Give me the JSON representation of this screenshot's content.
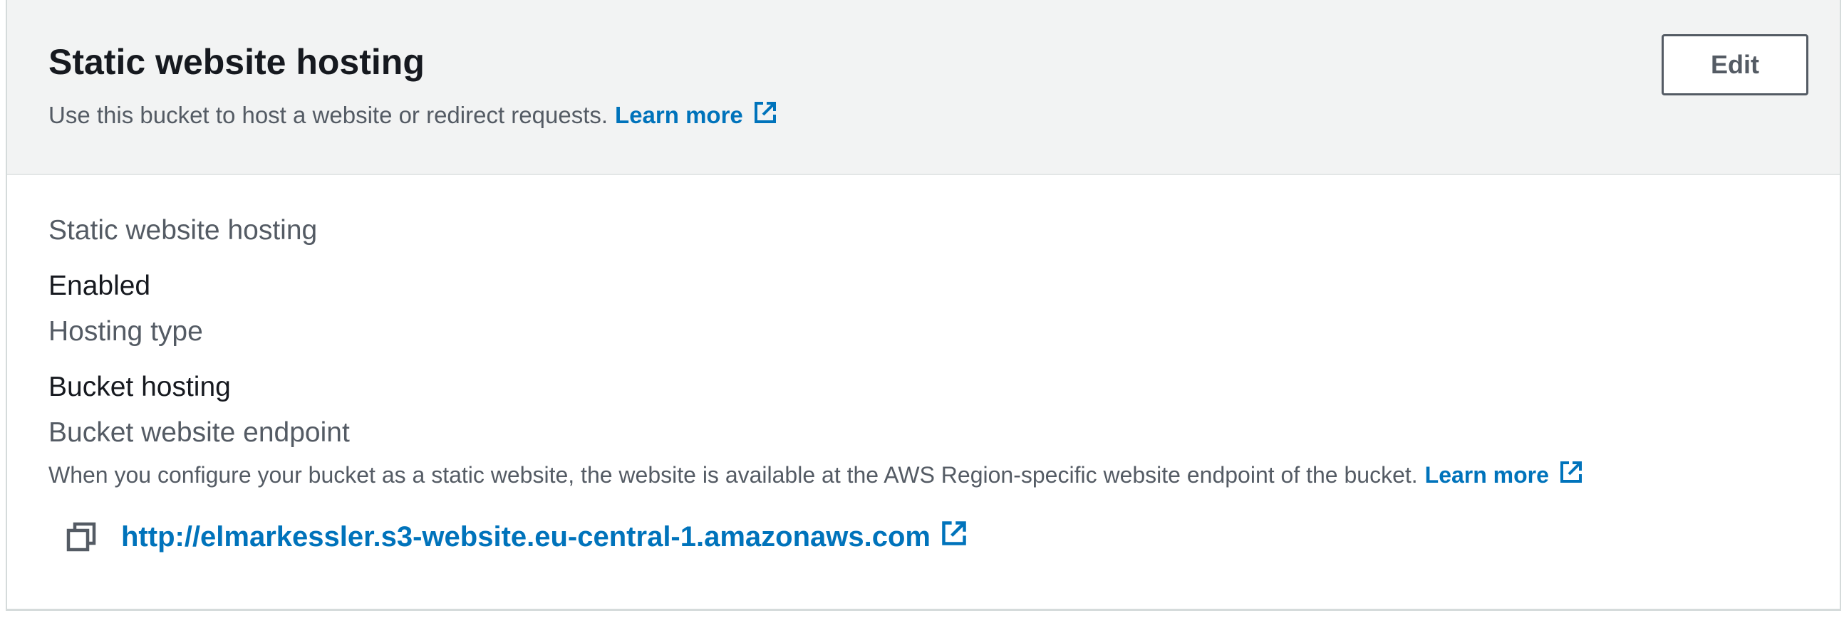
{
  "header": {
    "title": "Static website hosting",
    "description": "Use this bucket to host a website or redirect requests.",
    "learn_more_label": "Learn more",
    "edit_label": "Edit"
  },
  "details": {
    "hosting_label": "Static website hosting",
    "hosting_value": "Enabled",
    "type_label": "Hosting type",
    "type_value": "Bucket hosting",
    "endpoint_label": "Bucket website endpoint",
    "endpoint_description": "When you configure your bucket as a static website, the website is available at the AWS Region-specific website endpoint of the bucket.",
    "endpoint_learn_more_label": "Learn more",
    "endpoint_url": "http://elmarkessler.s3-website.eu-central-1.amazonaws.com"
  },
  "icons": {
    "external_link": "external-link-icon",
    "copy": "copy-icon"
  },
  "colors": {
    "link": "#0073bb",
    "header_bg": "#f2f3f3",
    "text_primary": "#16191f",
    "text_secondary": "#545b64"
  }
}
